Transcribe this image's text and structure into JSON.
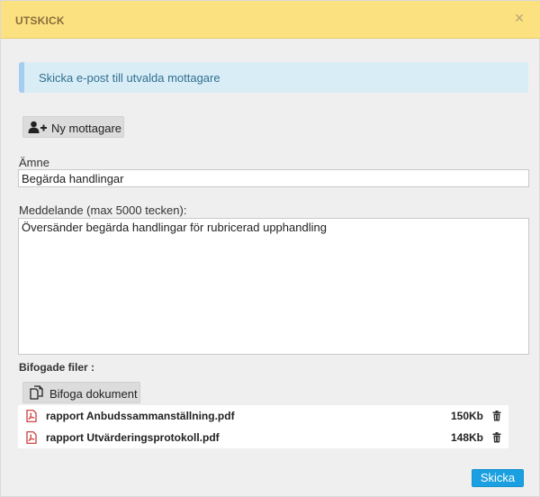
{
  "dialog": {
    "title": "UTSKICK",
    "close_symbol": "×"
  },
  "info_banner": {
    "text": "Skicka e-post till utvalda mottagare"
  },
  "new_recipient_button": {
    "label": "Ny mottagare",
    "icon": "add-user-icon"
  },
  "subject": {
    "label": "Ämne",
    "value": "Begärda handlingar"
  },
  "message": {
    "label": "Meddelande (max 5000 tecken):",
    "value": "Översänder begärda handlingar för rubricerad upphandling"
  },
  "attachments": {
    "heading": "Bifogade filer :",
    "attach_button_label": "Bifoga dokument",
    "attach_icon": "copy-documents-icon",
    "files": [
      {
        "name": "rapport Anbudssammanställning.pdf",
        "size": "150Kb",
        "icon": "pdf-icon"
      },
      {
        "name": "rapport Utvärderingsprotokoll.pdf",
        "size": "148Kb",
        "icon": "pdf-icon"
      }
    ]
  },
  "send_button": {
    "label": "Skicka"
  },
  "colors": {
    "header_bg": "#fce181",
    "header_text": "#8a6d3b",
    "banner_bg": "#d9edf7",
    "banner_border": "#a6cdf0",
    "send_button_bg": "#1aa0e0",
    "pdf_red": "#c9302c"
  }
}
